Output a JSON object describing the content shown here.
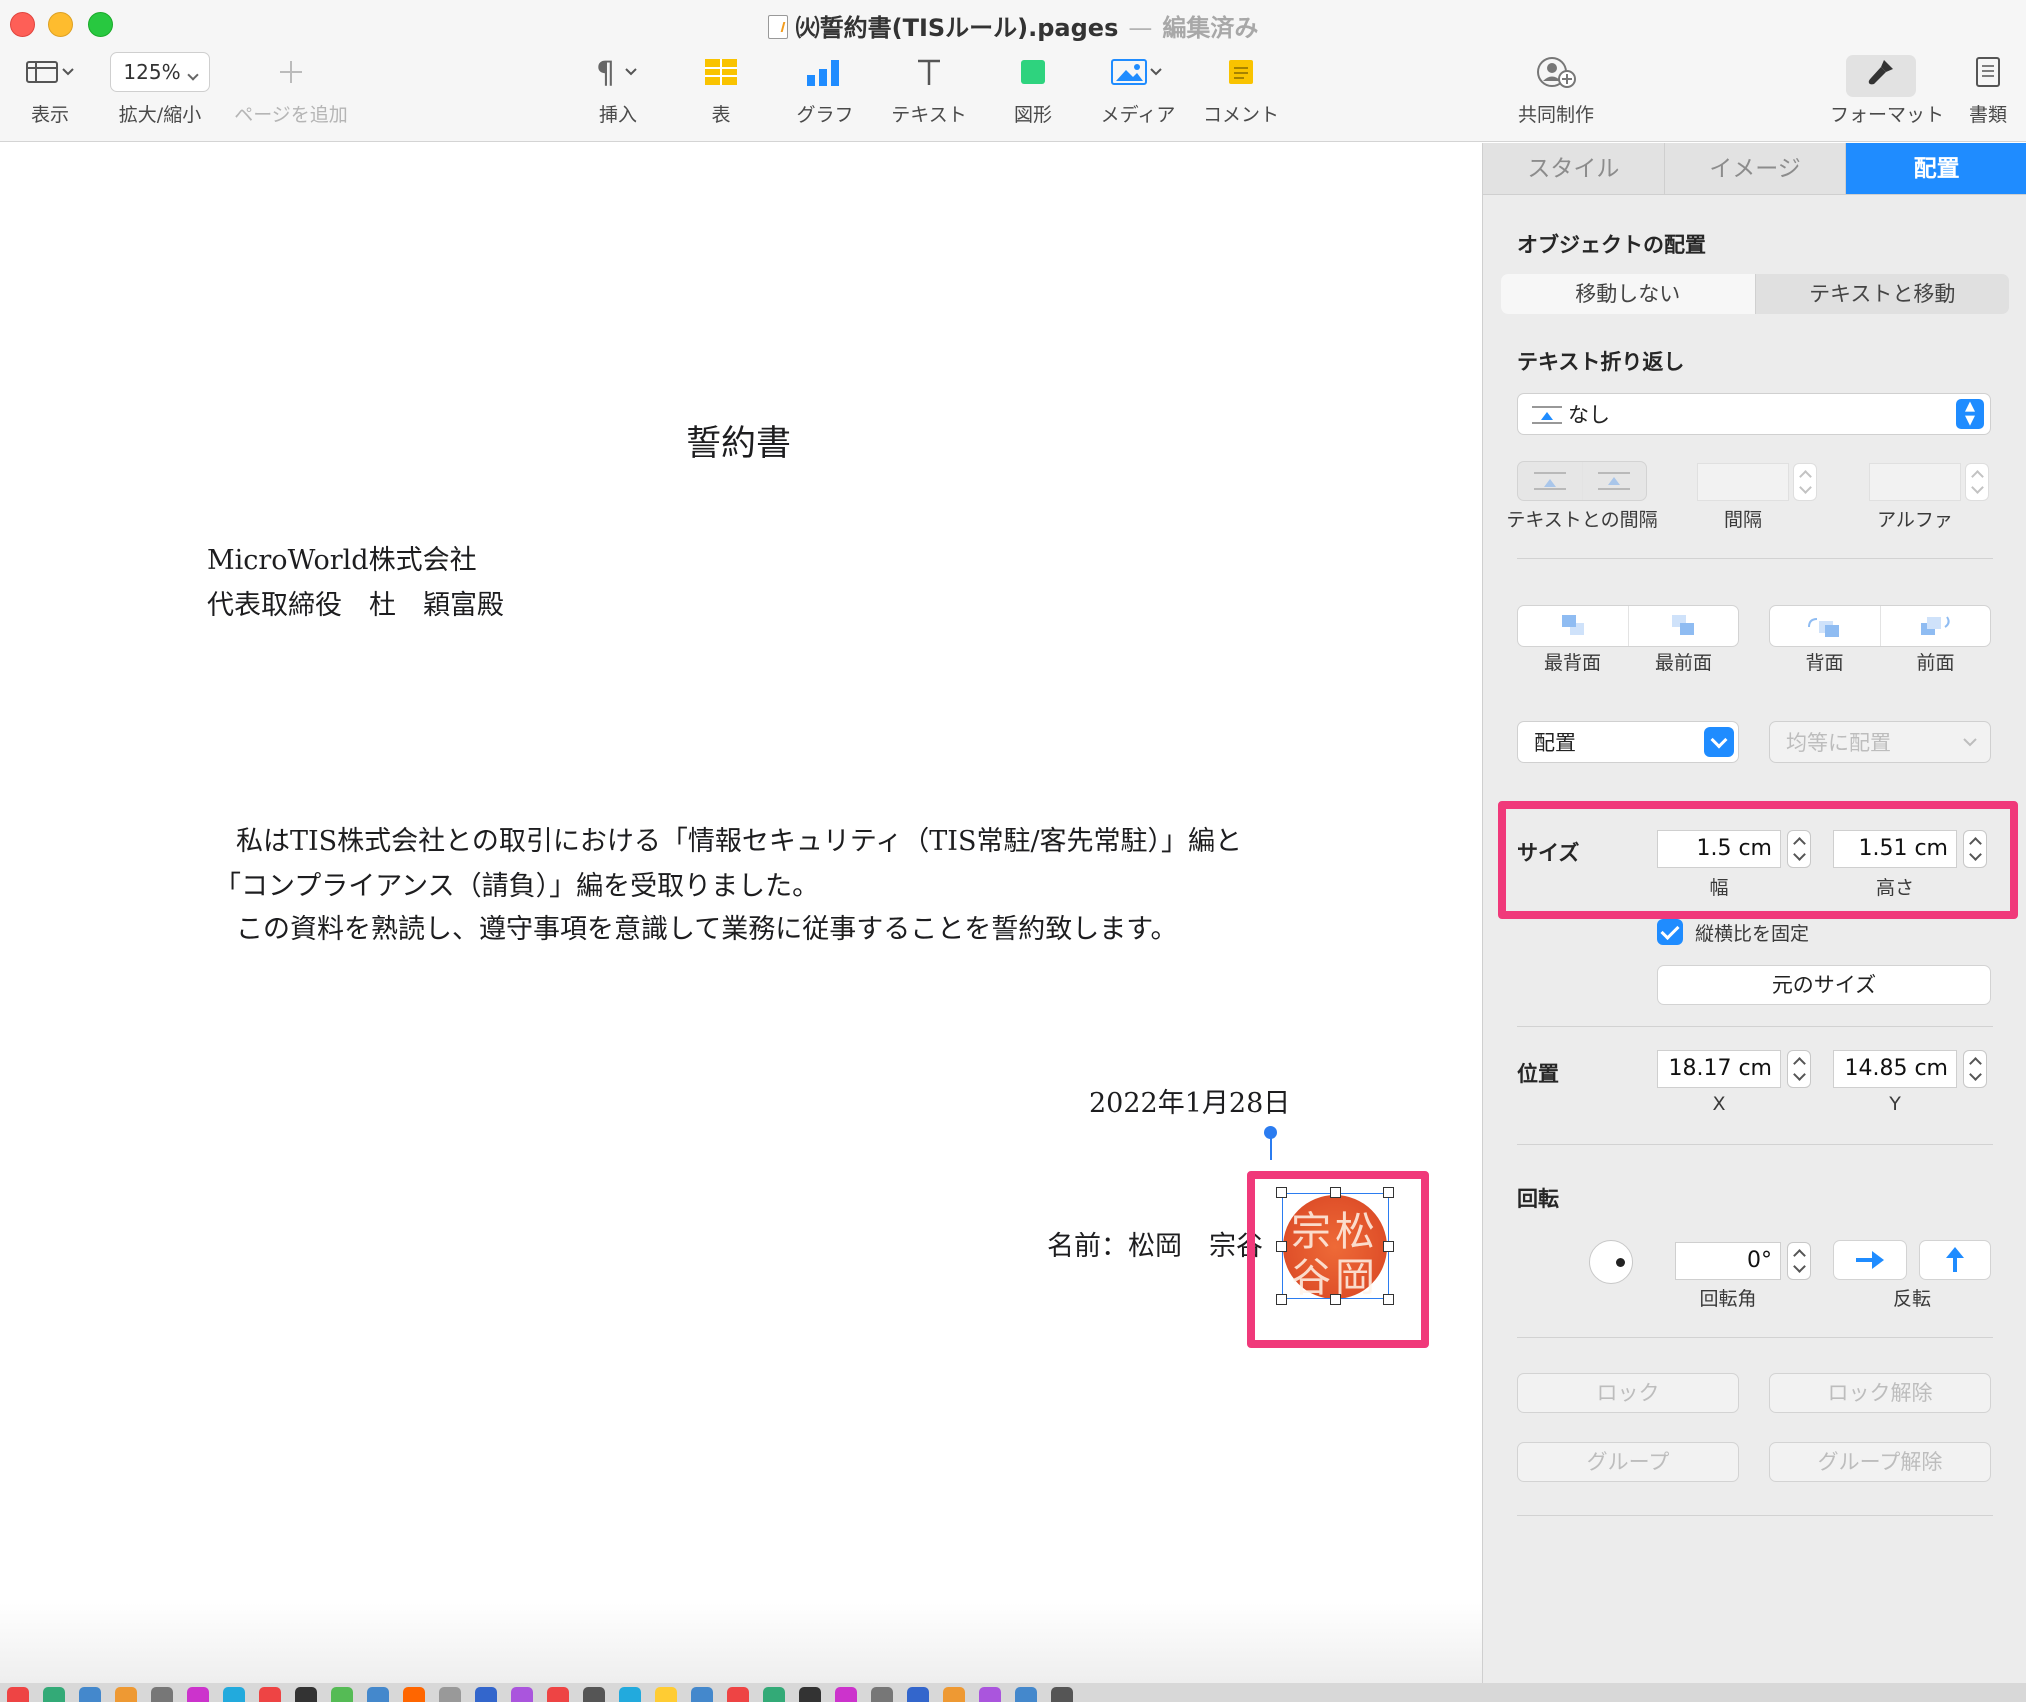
{
  "window": {
    "title": "㈫誓約書(TISルール).pages",
    "title_separator": "—",
    "status": "編集済み"
  },
  "toolbar": {
    "view_label": "表示",
    "zoom_value": "125%",
    "zoom_label": "拡大/縮小",
    "add_page_label": "ページを追加",
    "insert_label": "挿入",
    "table_label": "表",
    "chart_label": "グラフ",
    "text_label": "テキスト",
    "shape_label": "図形",
    "media_label": "メディア",
    "comment_label": "コメント",
    "collaborate_label": "共同制作",
    "format_label": "フォーマット",
    "document_label": "書類"
  },
  "document": {
    "title": "誓約書",
    "addressee_company": "MicroWorld株式会社",
    "addressee_person": "代表取締役　杜　穎富殿",
    "body_line1": "私はTIS株式会社との取引における「情報セキュリティ（TIS常駐/客先常駐）」編と",
    "body_line2": "「コンプライアンス（請負）」編を受取りました。",
    "body_line3": "この資料を熟読し、遵守事項を意識して業務に従事することを誓約致します。",
    "date": "2022年1月28日",
    "signature": "名前：松岡　宗谷",
    "stamp_chars": [
      "松",
      "岡",
      "宗",
      "谷"
    ]
  },
  "inspector": {
    "tabs": [
      "スタイル",
      "イメージ",
      "配置"
    ],
    "active_tab": "配置",
    "object_placement": {
      "title": "オブジェクトの配置",
      "options": [
        "移動しない",
        "テキストと移動"
      ]
    },
    "text_wrap": {
      "title": "テキスト折り返し",
      "value": "なし",
      "spacing_label": "テキストとの間隔",
      "gap_label": "間隔",
      "alpha_label": "アルファ"
    },
    "arrange": {
      "back_label": "最背面",
      "front_label": "最前面",
      "backward_label": "背面",
      "forward_label": "前面",
      "align_label": "配置",
      "distribute_label": "均等に配置"
    },
    "size": {
      "title": "サイズ",
      "width": "1.5 cm",
      "height": "1.51 cm",
      "width_label": "幅",
      "height_label": "高さ",
      "constrain_label": "縦横比を固定",
      "original_size_label": "元のサイズ"
    },
    "position": {
      "title": "位置",
      "x": "18.17 cm",
      "y": "14.85 cm",
      "x_label": "X",
      "y_label": "Y"
    },
    "rotate": {
      "title": "回転",
      "angle": "0°",
      "angle_label": "回転角",
      "flip_label": "反転"
    },
    "lock_label": "ロック",
    "unlock_label": "ロック解除",
    "group_label": "グループ",
    "ungroup_label": "グループ解除"
  },
  "colors": {
    "accent": "#1f8cff",
    "highlight": "#f0397a",
    "stamp": "#e0512a"
  }
}
